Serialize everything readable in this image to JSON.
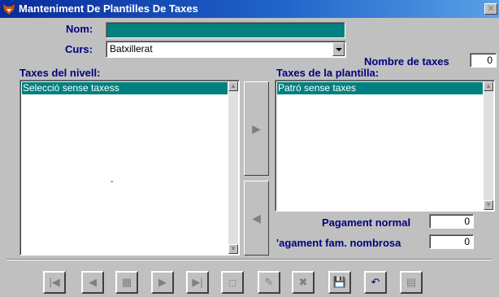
{
  "window": {
    "title": "Manteniment De Plantilles De Taxes"
  },
  "form": {
    "nom_label": "Nom:",
    "nom_value": "",
    "curs_label": "Curs:",
    "curs_value": "Batxillerat",
    "nombre_label": "Nombre de taxes",
    "nombre_value": "0"
  },
  "left_list": {
    "label": "Taxes del nivell:",
    "items": [
      "Selecció sense taxess"
    ]
  },
  "right_list": {
    "label": "Taxes de la plantilla:",
    "items": [
      "Patró sense taxes"
    ]
  },
  "totals": {
    "normal_label": "Pagament normal",
    "normal_value": "0",
    "fam_label": "'agament fam. nombrosa",
    "fam_value": "0"
  },
  "toolbar": {
    "buttons": [
      "first-record",
      "previous-record",
      "search",
      "next-record",
      "last-record",
      "new-record",
      "edit-record",
      "delete-record",
      "save",
      "undo",
      "print"
    ],
    "icons": [
      "|◀",
      "◀",
      "▦",
      "▶",
      "▶|",
      "□",
      "✎",
      "✖",
      "💾",
      "↶",
      "▤"
    ]
  },
  "colors": {
    "title_bar": "#0a2a9a",
    "label_text": "#00007f",
    "selection": "#00807f",
    "face": "#c0c0c0"
  }
}
